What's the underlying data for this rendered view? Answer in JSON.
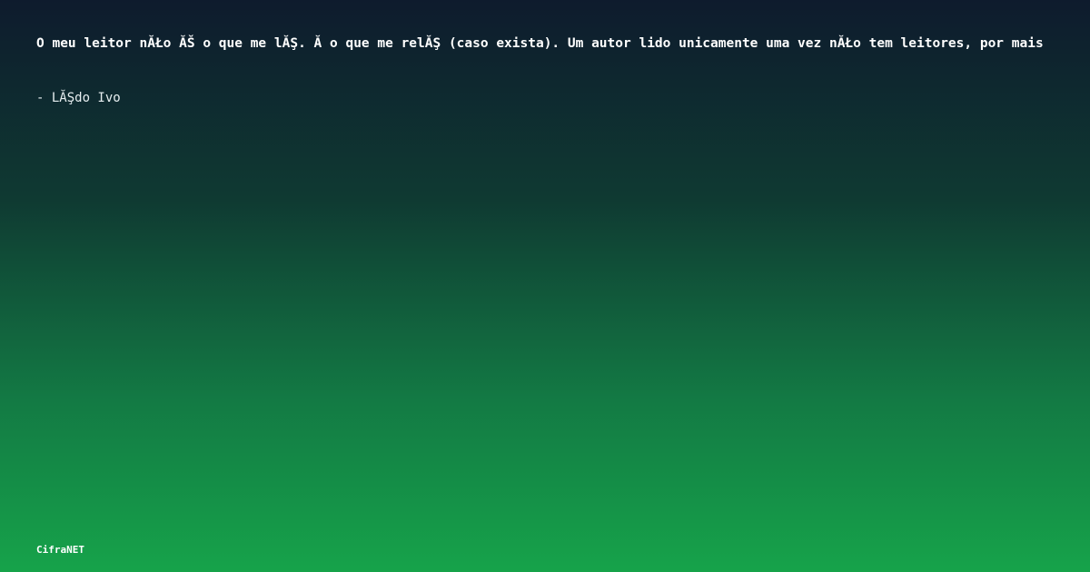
{
  "quote": {
    "text": "O meu leitor nĂŁo ĂŠ o que me lĂŞ. Ă o que me relĂŞ (caso exista). Um autor lido unicamente uma vez nĂŁo tem leitores, por mais",
    "author": "- LĂŞdo Ivo"
  },
  "brand": {
    "name": "CifraNET"
  },
  "colors": {
    "gradient_top": "#0e1b2d",
    "gradient_bottom": "#16a34a",
    "text": "#ffffff"
  }
}
